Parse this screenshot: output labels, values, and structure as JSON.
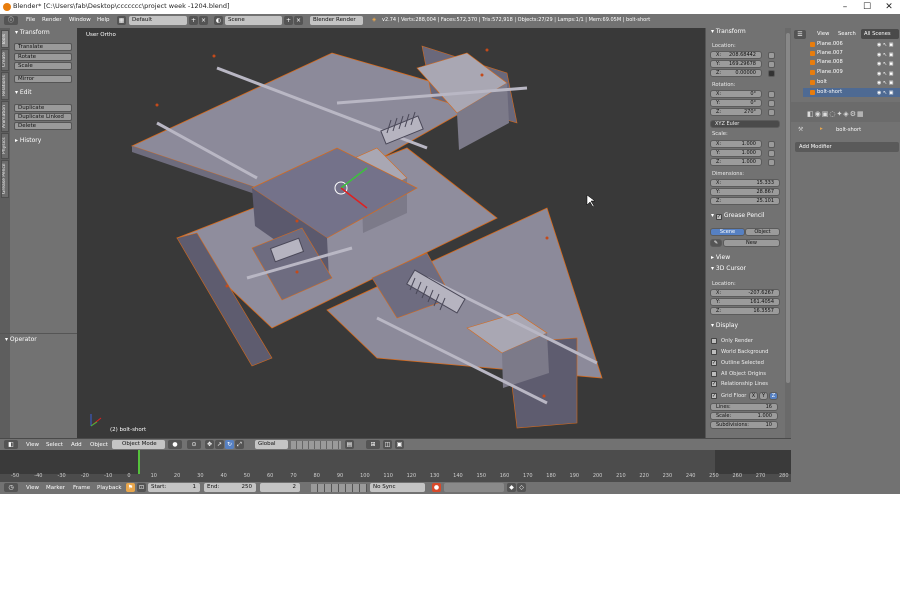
{
  "window": {
    "title": "Blender* [C:\\Users\\fab\\Desktop\\ccccccc\\project week -1204.blend]",
    "minimize": "–",
    "maximize": "☐",
    "close": "✕"
  },
  "info_header": {
    "menus": [
      "File",
      "Render",
      "Window",
      "Help"
    ],
    "layout": "Default",
    "scene": "Scene",
    "engine": "Blender Render",
    "stats": "v2.74 | Verts:288,004 | Faces:572,370 | Tris:572,918 | Objects:27/29 | Lamps:1/1 | Mem:69.05M | bolt-short"
  },
  "tool_shelf": {
    "tabs": [
      "Tools",
      "Create",
      "Relations",
      "Animation",
      "Physics",
      "Grease Pencil"
    ],
    "transform_header": "Transform",
    "transform_buttons": [
      "Translate",
      "Rotate",
      "Scale"
    ],
    "mirror": "Mirror",
    "edit_header": "Edit",
    "edit_buttons": [
      "Duplicate",
      "Duplicate Linked",
      "Delete"
    ],
    "history_header": "History",
    "operator_header": "Operator"
  },
  "viewport": {
    "view_label": "User Ortho",
    "object_label": "(2) bolt-short"
  },
  "n_panel": {
    "transform_header": "Transform",
    "location_label": "Location:",
    "location": [
      {
        "axis": "X:",
        "value": "208.68442"
      },
      {
        "axis": "Y:",
        "value": "169.29678"
      },
      {
        "axis": "Z:",
        "value": "0.00000"
      }
    ],
    "rotation_label": "Rotation:",
    "rotation": [
      {
        "axis": "X:",
        "value": "0°"
      },
      {
        "axis": "Y:",
        "value": "0°"
      },
      {
        "axis": "Z:",
        "value": "270°"
      }
    ],
    "rotation_mode": "XYZ Euler",
    "scale_label": "Scale:",
    "scale": [
      {
        "axis": "X:",
        "value": "1.000"
      },
      {
        "axis": "Y:",
        "value": "1.000"
      },
      {
        "axis": "Z:",
        "value": "1.000"
      }
    ],
    "dimensions_label": "Dimensions:",
    "dimensions": [
      {
        "axis": "X:",
        "value": "15.333"
      },
      {
        "axis": "Y:",
        "value": "28.867"
      },
      {
        "axis": "Z:",
        "value": "25.101"
      }
    ],
    "grease_pencil_header": "Grease Pencil",
    "gp_scene": "Scene",
    "gp_object": "Object",
    "gp_new": "New",
    "view_header": "View",
    "cursor_header": "3D Cursor",
    "cursor_location_label": "Location:",
    "cursor": [
      {
        "axis": "X:",
        "value": "-207.6267"
      },
      {
        "axis": "Y:",
        "value": "161.4054"
      },
      {
        "axis": "Z:",
        "value": "16.3557"
      }
    ],
    "display_header": "Display",
    "display_options": [
      {
        "label": "Only Render",
        "checked": false
      },
      {
        "label": "World Background",
        "checked": false
      },
      {
        "label": "Outline Selected",
        "checked": true
      },
      {
        "label": "All Object Origins",
        "checked": false
      },
      {
        "label": "Relationship Lines",
        "checked": true
      }
    ],
    "grid_floor": "Grid Floor",
    "grid_axes": [
      "X",
      "Y",
      "Z"
    ],
    "grid": [
      {
        "label": "Lines:",
        "value": "16"
      },
      {
        "label": "Scale:",
        "value": "1.000"
      },
      {
        "label": "Subdivisions:",
        "value": "10"
      }
    ]
  },
  "outliner": {
    "tabs": [
      "View",
      "Search",
      "All Scenes"
    ],
    "items": [
      "Plane.006",
      "Plane.007",
      "Plane.008",
      "Plane.009",
      "bolt",
      "bolt-short"
    ]
  },
  "properties": {
    "object_name": "bolt-short",
    "add_modifier": "Add Modifier"
  },
  "view3d_header": {
    "menus": [
      "View",
      "Select",
      "Add",
      "Object"
    ],
    "mode": "Object Mode",
    "orientation": "Global"
  },
  "timeline": {
    "ticks": [
      "-50",
      "-40",
      "-30",
      "-20",
      "-10",
      "0",
      "10",
      "20",
      "30",
      "40",
      "50",
      "60",
      "70",
      "80",
      "90",
      "100",
      "110",
      "120",
      "130",
      "140",
      "150",
      "160",
      "170",
      "180",
      "190",
      "200",
      "210",
      "220",
      "230",
      "240",
      "250",
      "260",
      "270",
      "280"
    ],
    "current_frame": "2",
    "menus": [
      "View",
      "Marker",
      "Frame",
      "Playback"
    ],
    "start_label": "Start:",
    "start": "1",
    "end_label": "End:",
    "end": "250",
    "frame": "2",
    "sync": "No Sync"
  },
  "colors": {
    "ui_gray": "#727272",
    "viewport_bg": "#393939",
    "selection_orange": "#e87d0d",
    "accent_blue": "#5680c2"
  }
}
